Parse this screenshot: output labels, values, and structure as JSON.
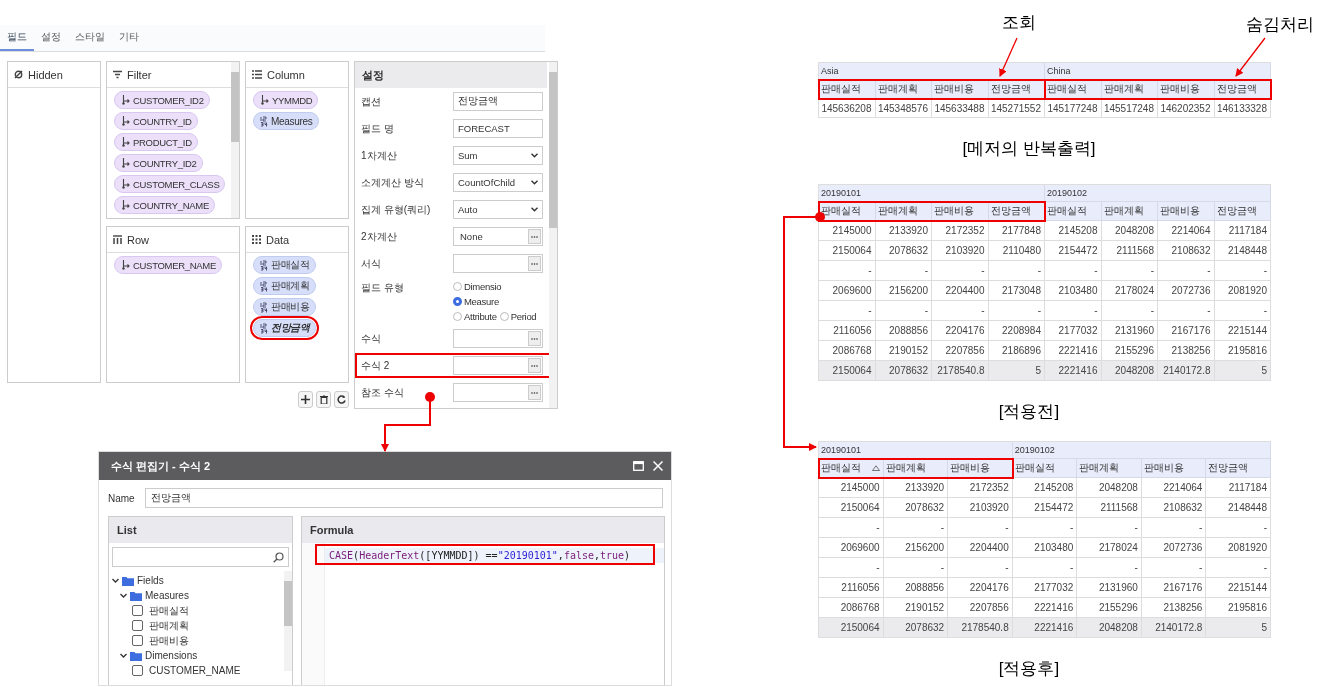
{
  "tabs": [
    {
      "label": "필드",
      "selected": true
    },
    {
      "label": "설정",
      "selected": false
    },
    {
      "label": "스타일",
      "selected": false
    },
    {
      "label": "기타",
      "selected": false
    }
  ],
  "field_panels": [
    {
      "kind": "hidden",
      "title": "Hidden"
    },
    {
      "kind": "filter",
      "title": "Filter",
      "chips": [
        {
          "label": "CUSTOMER_ID2",
          "kind": "dimension",
          "highlighted": false
        },
        {
          "label": "COUNTRY_ID",
          "kind": "dimension",
          "highlighted": false
        },
        {
          "label": "PRODUCT_ID",
          "kind": "dimension",
          "highlighted": false
        },
        {
          "label": "COUNTRY_ID2",
          "kind": "dimension",
          "highlighted": false
        },
        {
          "label": "CUSTOMER_CLASS",
          "kind": "dimension",
          "highlighted": false
        },
        {
          "label": "COUNTRY_NAME",
          "kind": "dimension",
          "highlighted": false
        }
      ]
    },
    {
      "kind": "column",
      "title": "Column",
      "chips": [
        {
          "label": "YYMMDD",
          "kind": "dimension",
          "highlighted": false
        },
        {
          "label": "Measures",
          "kind": "measure",
          "highlighted": false
        }
      ]
    },
    {
      "kind": "row",
      "title": "Row",
      "chips": [
        {
          "label": "CUSTOMER_NAME",
          "kind": "dimension",
          "highlighted": false
        }
      ]
    },
    {
      "kind": "data",
      "title": "Data",
      "chips": [
        {
          "label": "판매실적",
          "kind": "measure",
          "highlighted": false
        },
        {
          "label": "판매계획",
          "kind": "measure",
          "highlighted": false
        },
        {
          "label": "판매비용",
          "kind": "measure",
          "highlighted": false
        },
        {
          "label": "전망금액",
          "kind": "measure",
          "highlighted": true
        }
      ]
    }
  ],
  "settings": {
    "title": "설정",
    "rows": [
      {
        "label": "캡션",
        "kind": "text",
        "value": "전망금액",
        "highlighted": false
      },
      {
        "label": "필드 명",
        "kind": "text",
        "value": "FORECAST",
        "highlighted": false
      },
      {
        "label": "1차계산",
        "kind": "select",
        "value": "Sum",
        "highlighted": false
      },
      {
        "label": "소계계산 방식",
        "kind": "select",
        "value": "CountOfChild",
        "highlighted": false
      },
      {
        "label": "집계 유형(쿼리)",
        "kind": "select",
        "value": "Auto",
        "highlighted": false
      },
      {
        "label": "2차계산",
        "kind": "picker",
        "value": "None",
        "highlighted": false
      },
      {
        "label": "서식",
        "kind": "picker",
        "highlighted": false
      },
      {
        "label": "필드 유형",
        "kind": "radio",
        "highlighted": false,
        "options": [
          {
            "label": "Dimensio",
            "selected": false
          },
          {
            "label": "Measure",
            "selected": true
          },
          {
            "label": "Attribute",
            "selected": false
          },
          {
            "label": "Period",
            "selected": false
          }
        ]
      },
      {
        "label": "수식",
        "kind": "picker",
        "highlighted": false
      },
      {
        "label": "수식 2",
        "kind": "picker",
        "highlighted": true
      },
      {
        "label": "참조 수식",
        "kind": "picker",
        "highlighted": false
      }
    ]
  },
  "editor": {
    "title": "수식 편집기 - 수식 2",
    "name_label": "Name",
    "name_value": "전망금액",
    "list_title": "List",
    "formula_title": "Formula",
    "formula": {
      "highlighted": true,
      "tokens": [
        {
          "text": "CASE",
          "kind": "function"
        },
        {
          "text": "(",
          "kind": "plain"
        },
        {
          "text": "HeaderText",
          "kind": "function"
        },
        {
          "text": "([YYMMDD]) == ",
          "kind": "plain"
        },
        {
          "text": "\"20190101\"",
          "kind": "string"
        },
        {
          "text": ",",
          "kind": "plain"
        },
        {
          "text": "false",
          "kind": "keyword"
        },
        {
          "text": ",",
          "kind": "plain"
        },
        {
          "text": "true",
          "kind": "keyword"
        },
        {
          "text": ")",
          "kind": "plain"
        }
      ]
    },
    "tree": [
      {
        "label": "Fields",
        "kind": "folder",
        "expanded": true,
        "children": [
          {
            "label": "Measures",
            "kind": "folder",
            "expanded": true,
            "children": [
              {
                "label": "판매실적",
                "kind": "field",
                "checked": false
              },
              {
                "label": "판매계획",
                "kind": "field",
                "checked": false
              },
              {
                "label": "판매비용",
                "kind": "field",
                "checked": false
              }
            ]
          },
          {
            "label": "Dimensions",
            "kind": "folder",
            "expanded": true,
            "children": [
              {
                "label": "CUSTOMER_NAME",
                "kind": "field",
                "checked": false
              }
            ]
          }
        ]
      }
    ]
  },
  "annotations": {
    "query_label": "조회",
    "hide_label": "숨김처리"
  },
  "tables": [
    {
      "caption": "[메저의 반복출력]",
      "groups": [
        {
          "label": "Asia",
          "highlighted": true,
          "columns": [
            {
              "label": "판매실적",
              "sorted": false
            },
            {
              "label": "판매계획",
              "sorted": false
            },
            {
              "label": "판매비용",
              "sorted": false
            },
            {
              "label": "전망금액",
              "sorted": false
            }
          ]
        },
        {
          "label": "China",
          "highlighted": true,
          "columns": [
            {
              "label": "판매실적",
              "sorted": false
            },
            {
              "label": "판매계획",
              "sorted": false
            },
            {
              "label": "판매비용",
              "sorted": false
            },
            {
              "label": "전망금액",
              "sorted": false
            }
          ]
        }
      ],
      "rows": [
        {
          "kind": "data",
          "cells": [
            "145636208",
            "145348576",
            "145633488",
            "145271552",
            "145177248",
            "145517248",
            "146202352",
            "146133328"
          ]
        }
      ]
    },
    {
      "caption": "[적용전]",
      "groups": [
        {
          "label": "20190101",
          "highlighted": true,
          "columns": [
            {
              "label": "판매실적",
              "sorted": false
            },
            {
              "label": "판매계획",
              "sorted": false
            },
            {
              "label": "판매비용",
              "sorted": false
            },
            {
              "label": "전망금액",
              "sorted": false
            }
          ]
        },
        {
          "label": "20190102",
          "highlighted": false,
          "columns": [
            {
              "label": "판매실적",
              "sorted": false
            },
            {
              "label": "판매계획",
              "sorted": false
            },
            {
              "label": "판매비용",
              "sorted": false
            },
            {
              "label": "전망금액",
              "sorted": false
            }
          ]
        }
      ],
      "rows": [
        {
          "kind": "data",
          "cells": [
            "2145000",
            "2133920",
            "2172352",
            "2177848",
            "2145208",
            "2048208",
            "2214064",
            "2117184"
          ]
        },
        {
          "kind": "data",
          "cells": [
            "2150064",
            "2078632",
            "2103920",
            "2110480",
            "2154472",
            "2111568",
            "2108632",
            "2148448"
          ]
        },
        {
          "kind": "data",
          "cells": [
            "-",
            "-",
            "-",
            "-",
            "-",
            "-",
            "-",
            "-"
          ]
        },
        {
          "kind": "data",
          "cells": [
            "2069600",
            "2156200",
            "2204400",
            "2173048",
            "2103480",
            "2178024",
            "2072736",
            "2081920"
          ]
        },
        {
          "kind": "data",
          "cells": [
            "-",
            "-",
            "-",
            "-",
            "-",
            "-",
            "-",
            "-"
          ]
        },
        {
          "kind": "data",
          "cells": [
            "2116056",
            "2088856",
            "2204176",
            "2208984",
            "2177032",
            "2131960",
            "2167176",
            "2215144"
          ]
        },
        {
          "kind": "data",
          "cells": [
            "2086768",
            "2190152",
            "2207856",
            "2186896",
            "2221416",
            "2155296",
            "2138256",
            "2195816"
          ]
        },
        {
          "kind": "total",
          "cells": [
            "2150064",
            "2078632",
            "2178540.8",
            "5",
            "2221416",
            "2048208",
            "2140172.8",
            "5"
          ]
        }
      ]
    },
    {
      "caption": "[적용후]",
      "groups": [
        {
          "label": "20190101",
          "highlighted": true,
          "columns": [
            {
              "label": "판매실적",
              "sorted": true
            },
            {
              "label": "판매계획",
              "sorted": false
            },
            {
              "label": "판매비용",
              "sorted": false
            }
          ]
        },
        {
          "label": "20190102",
          "highlighted": false,
          "columns": [
            {
              "label": "판매실적",
              "sorted": false
            },
            {
              "label": "판매계획",
              "sorted": false
            },
            {
              "label": "판매비용",
              "sorted": false
            },
            {
              "label": "전망금액",
              "sorted": false
            }
          ]
        }
      ],
      "rows": [
        {
          "kind": "data",
          "cells": [
            "2145000",
            "2133920",
            "2172352",
            "2145208",
            "2048208",
            "2214064",
            "2117184"
          ]
        },
        {
          "kind": "data",
          "cells": [
            "2150064",
            "2078632",
            "2103920",
            "2154472",
            "2111568",
            "2108632",
            "2148448"
          ]
        },
        {
          "kind": "data",
          "cells": [
            "-",
            "-",
            "-",
            "-",
            "-",
            "-",
            "-"
          ]
        },
        {
          "kind": "data",
          "cells": [
            "2069600",
            "2156200",
            "2204400",
            "2103480",
            "2178024",
            "2072736",
            "2081920"
          ]
        },
        {
          "kind": "data",
          "cells": [
            "-",
            "-",
            "-",
            "-",
            "-",
            "-",
            "-"
          ]
        },
        {
          "kind": "data",
          "cells": [
            "2116056",
            "2088856",
            "2204176",
            "2177032",
            "2131960",
            "2167176",
            "2215144"
          ]
        },
        {
          "kind": "data",
          "cells": [
            "2086768",
            "2190152",
            "2207856",
            "2221416",
            "2155296",
            "2138256",
            "2195816"
          ]
        },
        {
          "kind": "total",
          "cells": [
            "2150064",
            "2078632",
            "2178540.8",
            "2221416",
            "2048208",
            "2140172.8",
            "5"
          ]
        }
      ]
    }
  ]
}
